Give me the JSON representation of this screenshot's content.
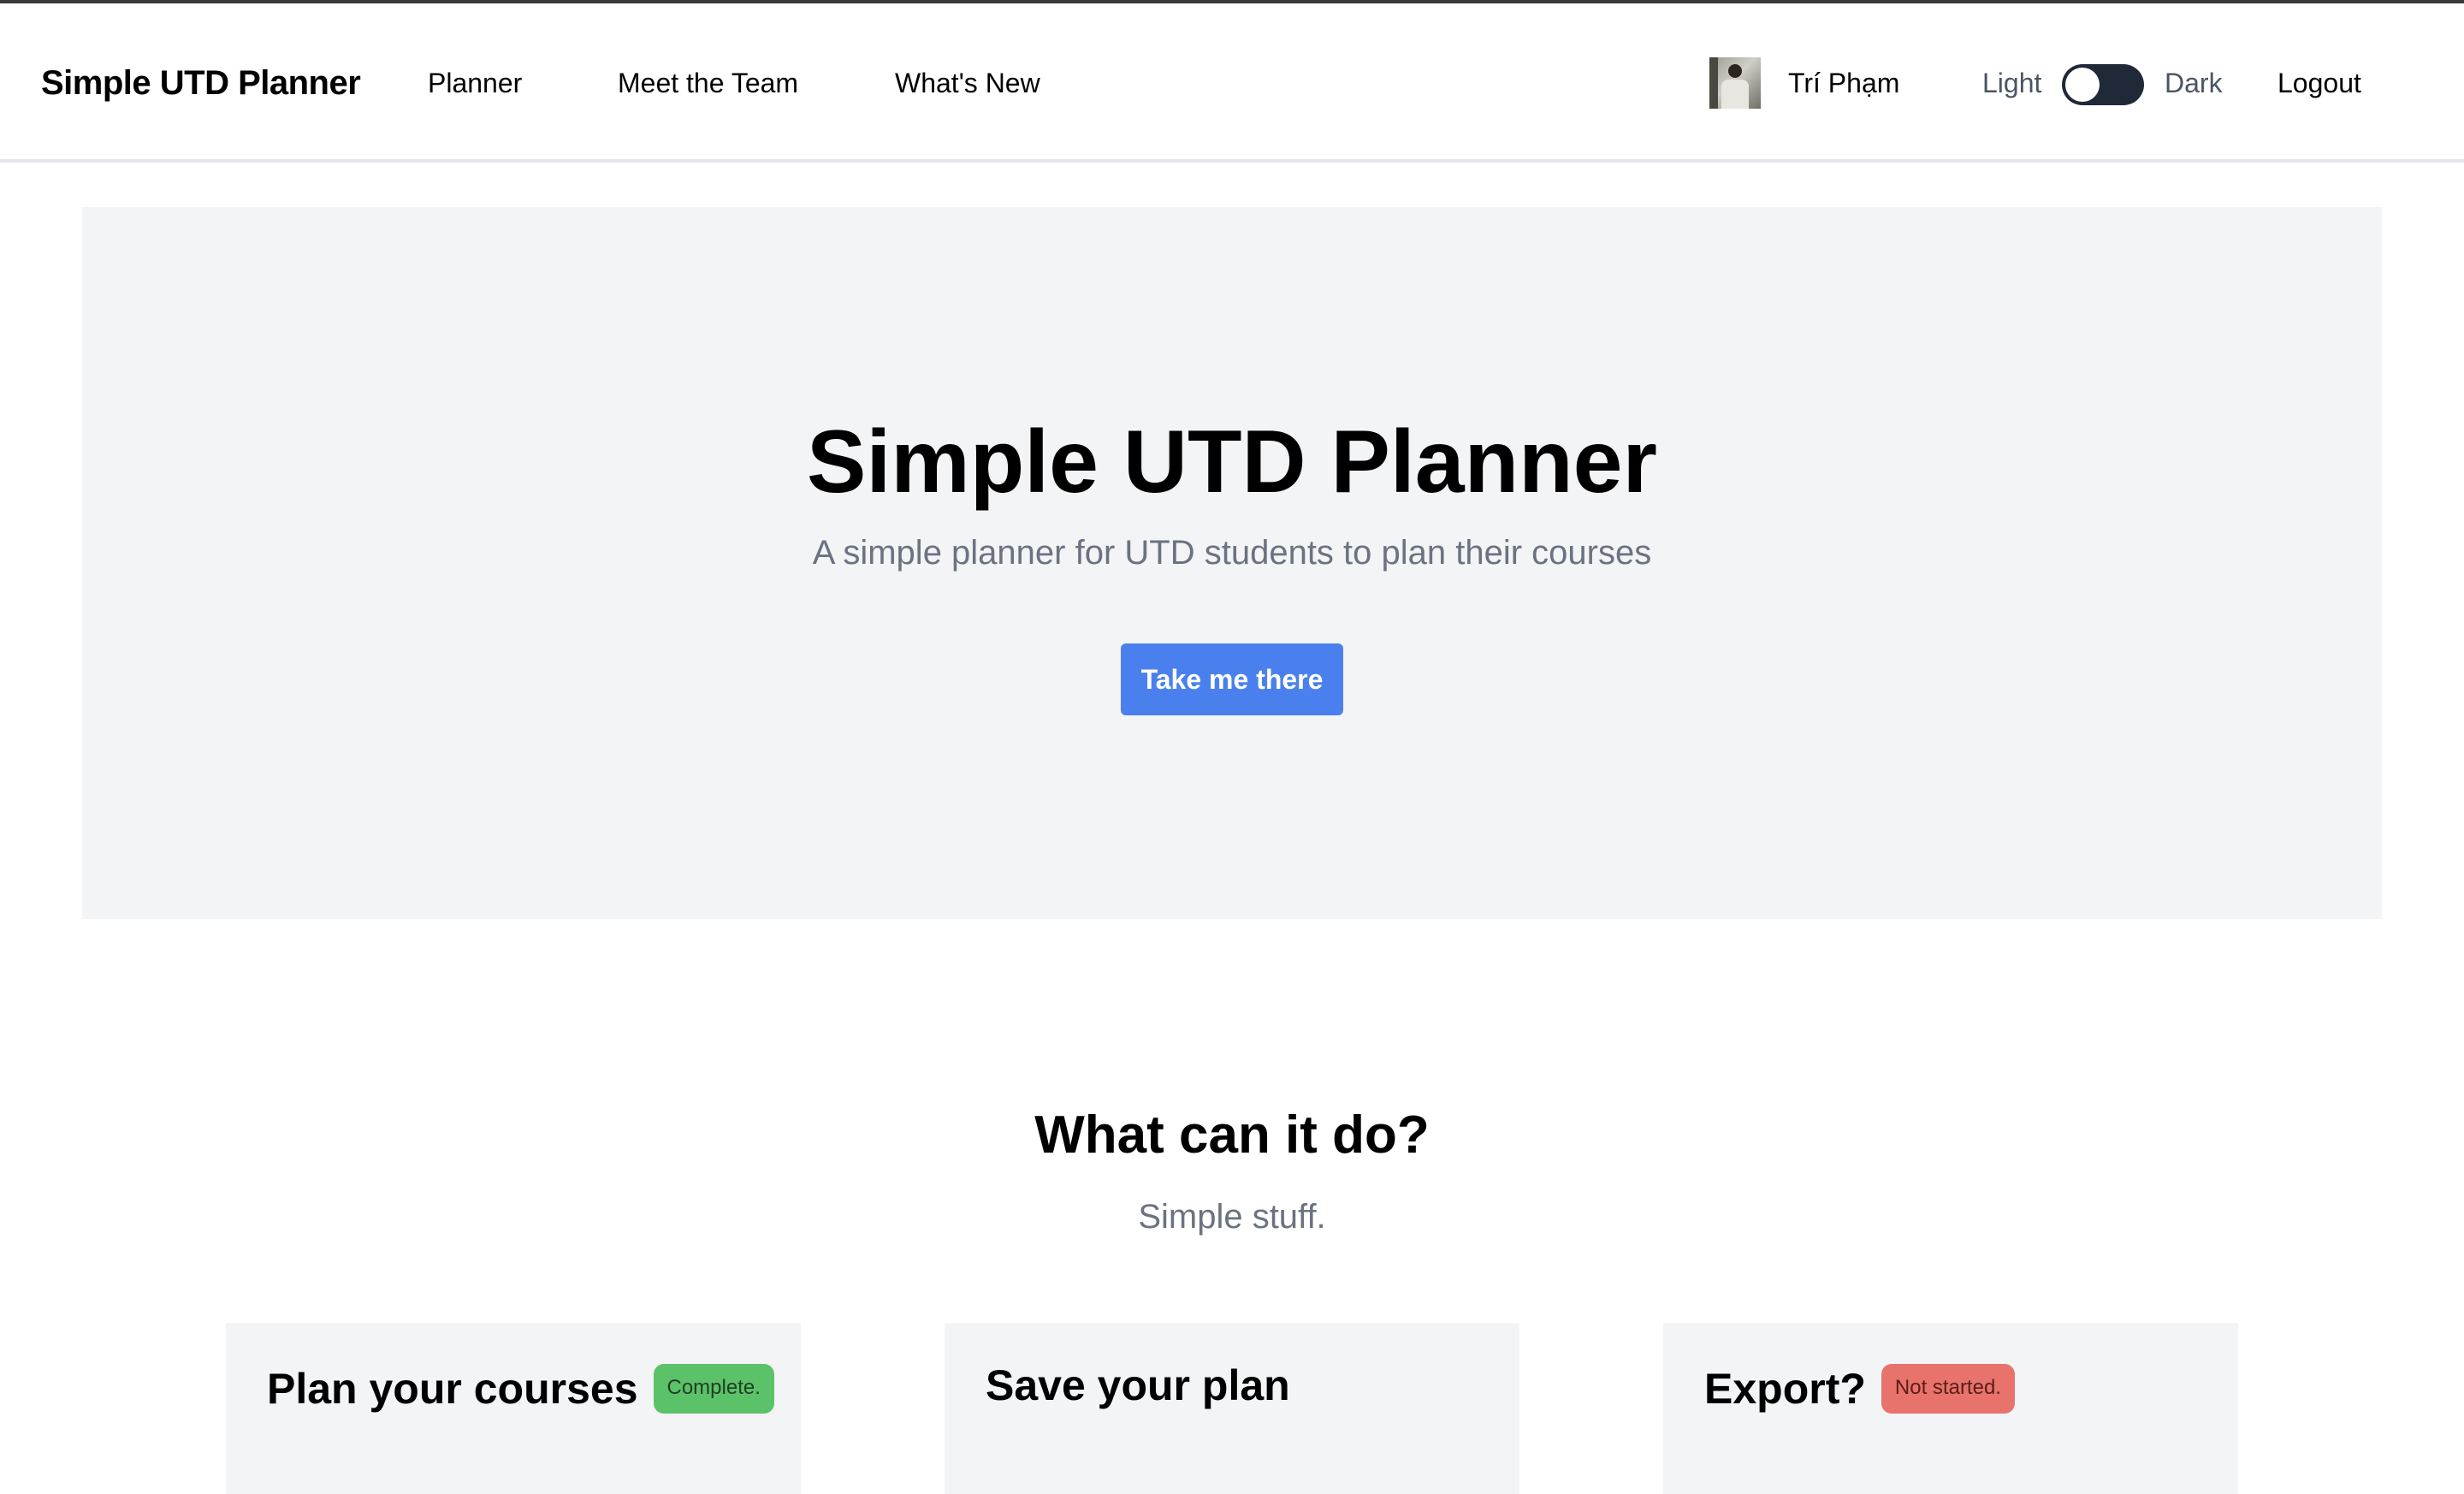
{
  "nav": {
    "brand": "Simple UTD Planner",
    "links": [
      "Planner",
      "Meet the Team",
      "What's New"
    ],
    "user_name": "Trí Phạm",
    "theme_light": "Light",
    "theme_dark": "Dark",
    "logout": "Logout"
  },
  "hero": {
    "title": "Simple UTD Planner",
    "subtitle": "A simple planner for UTD students to plan their courses",
    "button": "Take me there"
  },
  "features": {
    "title": "What can it do?",
    "subtitle": "Simple stuff.",
    "cards": [
      {
        "title": "Plan your courses",
        "badge": "Complete."
      },
      {
        "title": "Save your plan",
        "badge": ""
      },
      {
        "title": "Export?",
        "badge": "Not started."
      }
    ]
  },
  "colors": {
    "accent": "#4a80ee",
    "badge_complete": "#5cc26a",
    "badge_not_started": "#e8736c",
    "panel_bg": "#f3f4f6"
  },
  "icons": {
    "avatar": "user-avatar-photo"
  }
}
